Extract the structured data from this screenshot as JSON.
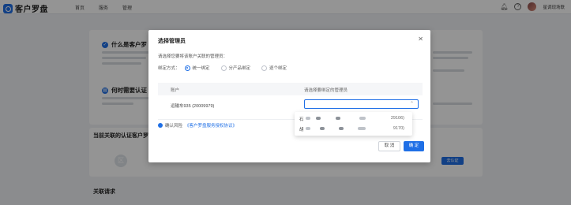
{
  "header": {
    "logo_text": "客户罗盘",
    "nav": [
      "首页",
      "服务",
      "管理"
    ],
    "bell_icon": "bell-icon",
    "help_icon": "help-icon",
    "user_name": "星调现场联"
  },
  "background": {
    "card_title_1": "什么是客户罗",
    "card_title_2": "何时需要认证",
    "section_title": "当前关联的认证客户罗",
    "avatar_text": "区",
    "bg_button_label": "去认证",
    "related_title": "关联请求"
  },
  "modal": {
    "title": "选择管理员",
    "description": "请选择您要将该账户关联的管理员：",
    "bind_label": "绑定方式：",
    "bind_options": [
      "统一绑定",
      "分产品绑定",
      "逐个绑定"
    ],
    "bind_selected": 0,
    "table": {
      "col_account": "账户",
      "col_admin": "请选择要绑定的管理员"
    },
    "row": {
      "account": "运输车935 (20009979)",
      "select_placeholder": ""
    },
    "dropdown": [
      {
        "name": "石",
        "number": "29106)"
      },
      {
        "name": "胡",
        "number": "9170)"
      }
    ],
    "footnote_prefix": "确认风险",
    "footnote_link": "《客户罗盘服务授权协议》",
    "cancel_label": "取 消",
    "ok_label": "确 定"
  }
}
